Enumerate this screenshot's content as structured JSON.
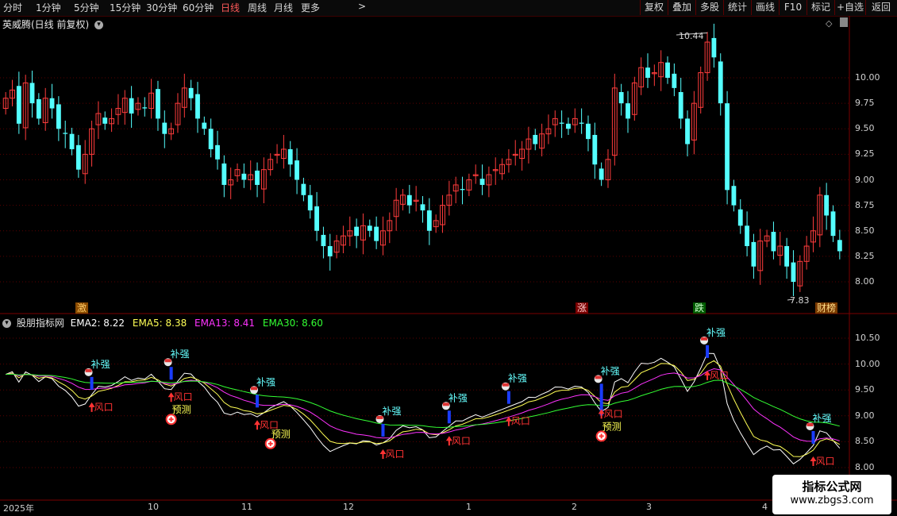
{
  "toolbar": {
    "periods": [
      "分时",
      "1分钟",
      "5分钟",
      "15分钟",
      "30分钟",
      "60分钟",
      "日线",
      "周线",
      "月线",
      "更多"
    ],
    "more_arrow": ">",
    "right_buttons": [
      "复权",
      "叠加",
      "多股",
      "统计",
      "画线",
      "F10",
      "标记",
      "+自选",
      "返回"
    ]
  },
  "main": {
    "title": "英威腾(日线 前复权)",
    "title_icon": "chevron-down-icon",
    "right_icon": "diamond-icon",
    "high_label": "10.44",
    "low_label": "7.83",
    "price_labels": [
      "10.00",
      "9.75",
      "9.50",
      "9.25",
      "9.00",
      "8.75",
      "8.50",
      "8.25",
      "8.00"
    ],
    "event_tags": [
      "激",
      "涨",
      "跌",
      "财榜"
    ]
  },
  "indicator": {
    "name": "股朋指标网",
    "ema2": "EMA2: 8.22",
    "ema5": "EMA5: 8.38",
    "ema13": "EMA13: 8.41",
    "ema30": "EMA30: 8.60",
    "price_labels": [
      "10.50",
      "10.00",
      "9.50",
      "9.00",
      "8.50",
      "8.00"
    ],
    "signal_labels": {
      "buqiang": "补强",
      "fengkou": "风口",
      "yuce": "预测"
    }
  },
  "x_axis": {
    "labels": [
      "2025年",
      "10",
      "11",
      "12",
      "1",
      "2",
      "3",
      "4"
    ]
  },
  "watermark": {
    "line1": "指标公式网",
    "line2": "www.zbgs3.com"
  },
  "colors": {
    "up": "#ff3c3c",
    "down": "#54ffff",
    "ema2": "#ffffff",
    "ema5": "#ffff55",
    "ema13": "#ff33ff",
    "ema30": "#33ff33"
  },
  "chart_data": {
    "type": "candlestick",
    "title": "英威腾(日线 前复权)",
    "ylim": [
      7.75,
      10.5
    ],
    "x_ticks": [
      "2025年",
      "10",
      "11",
      "12",
      "1",
      "2",
      "3",
      "4"
    ],
    "close_series": [
      9.8,
      9.88,
      9.55,
      9.95,
      9.75,
      9.6,
      9.8,
      9.7,
      9.5,
      9.45,
      9.3,
      9.1,
      9.25,
      9.5,
      9.65,
      9.55,
      9.6,
      9.7,
      9.8,
      9.65,
      9.75,
      9.7,
      9.85,
      9.6,
      9.45,
      9.5,
      9.75,
      9.9,
      9.8,
      9.6,
      9.5,
      9.3,
      9.2,
      8.95,
      9.0,
      9.1,
      9.0,
      9.05,
      8.95,
      9.1,
      9.2,
      9.25,
      9.3,
      9.15,
      9.0,
      8.85,
      8.7,
      8.5,
      8.35,
      8.25,
      8.4,
      8.45,
      8.5,
      8.45,
      8.55,
      8.5,
      8.4,
      8.5,
      8.6,
      8.8,
      8.85,
      8.75,
      8.8,
      8.7,
      8.5,
      8.6,
      8.75,
      8.85,
      8.95,
      8.9,
      9.0,
      9.05,
      8.95,
      9.05,
      9.1,
      9.15,
      9.2,
      9.25,
      9.3,
      9.4,
      9.35,
      9.45,
      9.5,
      9.6,
      9.55,
      9.5,
      9.6,
      9.55,
      9.4,
      9.15,
      9.0,
      9.2,
      9.9,
      9.75,
      9.6,
      9.95,
      10.1,
      10.0,
      10.05,
      10.15,
      10.0,
      9.9,
      9.6,
      9.35,
      9.75,
      10.05,
      10.35,
      10.2,
      9.75,
      8.9,
      8.75,
      8.55,
      8.35,
      8.15,
      8.4,
      8.45,
      8.3,
      8.35,
      8.15,
      8.0,
      8.2,
      8.35,
      8.5,
      8.85,
      8.65,
      8.45,
      8.3
    ],
    "ema2": 8.22,
    "ema5": 8.38,
    "ema13": 8.41,
    "ema30": 8.6,
    "high": 10.44,
    "low": 7.83
  }
}
